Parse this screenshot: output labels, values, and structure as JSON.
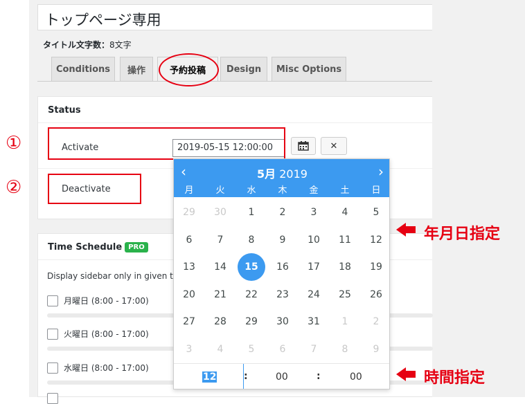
{
  "post_title": "トップページ専用",
  "title_count": {
    "label": "タイトル文字数：",
    "value": "8文字"
  },
  "tabs": [
    {
      "label": "Conditions"
    },
    {
      "label": "操作"
    },
    {
      "label": "予約投稿"
    },
    {
      "label": "Design"
    },
    {
      "label": "Misc Options"
    }
  ],
  "status_box": {
    "title": "Status",
    "activate_label": "Activate",
    "activate_value": "2019-05-15 12:00:00",
    "deactivate_label": "Deactivate",
    "calendar_icon": "calendar-icon",
    "clear_icon": "close-icon",
    "clear_label": "✕"
  },
  "schedule_box": {
    "title": "Time Schedule",
    "badge": "PRO",
    "description": "Display sidebar only in given tir",
    "days": [
      {
        "label": "月曜日 (8:00 - 17:00)"
      },
      {
        "label": "火曜日 (8:00 - 17:00)"
      },
      {
        "label": "水曜日 (8:00 - 17:00)"
      }
    ]
  },
  "calendar": {
    "prev": "‹",
    "next": "›",
    "month": "5月",
    "year": "2019",
    "weekdays": [
      "月",
      "火",
      "水",
      "木",
      "金",
      "土",
      "日"
    ],
    "weeks": [
      [
        {
          "d": "29",
          "m": true
        },
        {
          "d": "30",
          "m": true
        },
        {
          "d": "1"
        },
        {
          "d": "2"
        },
        {
          "d": "3"
        },
        {
          "d": "4"
        },
        {
          "d": "5"
        }
      ],
      [
        {
          "d": "6"
        },
        {
          "d": "7"
        },
        {
          "d": "8"
        },
        {
          "d": "9"
        },
        {
          "d": "10"
        },
        {
          "d": "11"
        },
        {
          "d": "12"
        }
      ],
      [
        {
          "d": "13"
        },
        {
          "d": "14"
        },
        {
          "d": "15",
          "s": true
        },
        {
          "d": "16"
        },
        {
          "d": "17"
        },
        {
          "d": "18"
        },
        {
          "d": "19"
        }
      ],
      [
        {
          "d": "20"
        },
        {
          "d": "21"
        },
        {
          "d": "22"
        },
        {
          "d": "23"
        },
        {
          "d": "24"
        },
        {
          "d": "25"
        },
        {
          "d": "26"
        }
      ],
      [
        {
          "d": "27"
        },
        {
          "d": "28"
        },
        {
          "d": "29"
        },
        {
          "d": "30"
        },
        {
          "d": "31"
        },
        {
          "d": "1",
          "m": true
        },
        {
          "d": "2",
          "m": true
        }
      ],
      [
        {
          "d": "3",
          "m": true
        },
        {
          "d": "4",
          "m": true
        },
        {
          "d": "5",
          "m": true
        },
        {
          "d": "6",
          "m": true
        },
        {
          "d": "7",
          "m": true
        },
        {
          "d": "8",
          "m": true
        },
        {
          "d": "9",
          "m": true
        }
      ]
    ],
    "time": {
      "hour": "12",
      "minute": "00",
      "second": "00",
      "sep": ":"
    }
  },
  "annotations": {
    "marker_1": "①",
    "marker_2": "②",
    "date_note": "年月日指定",
    "time_note": "時間指定",
    "accent_color": "#e60012"
  },
  "colors": {
    "accent_blue": "#3c9af0",
    "pro_green": "#2ab24b"
  }
}
